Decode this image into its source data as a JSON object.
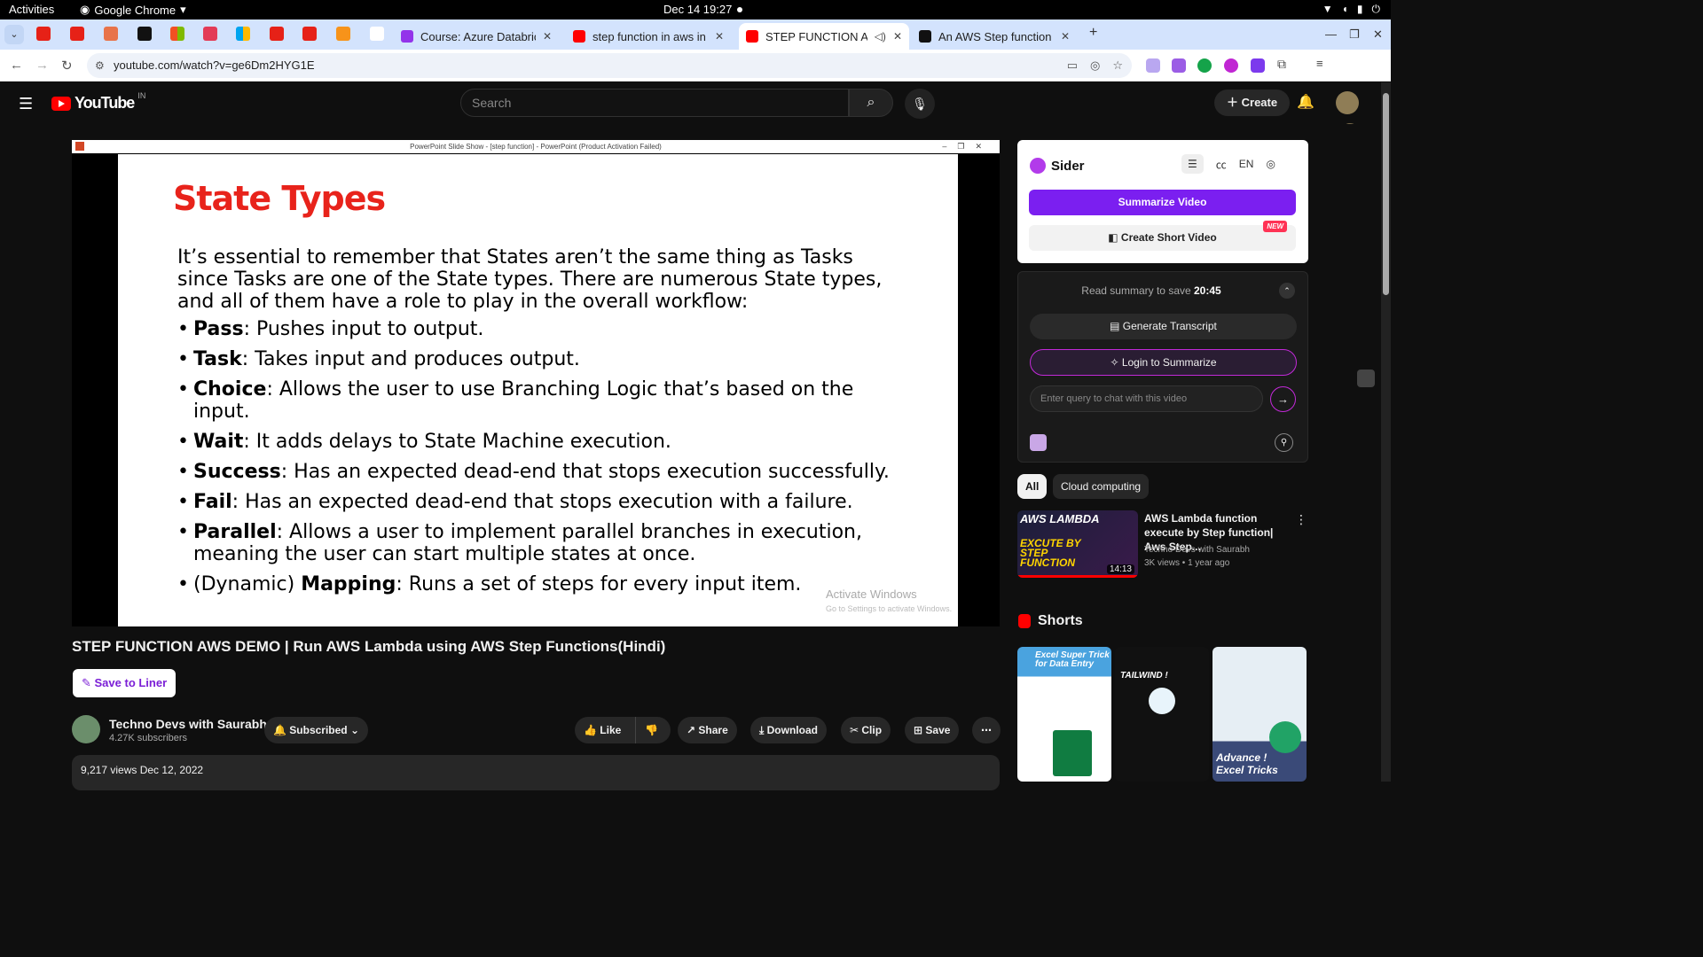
{
  "system": {
    "activities": "Activities",
    "app": "Google Chrome",
    "clock": "Dec 14  19:27"
  },
  "tabs": [
    {
      "label": "Course: Azure Databricks",
      "fav": "#9333ea"
    },
    {
      "label": "step function in aws in h",
      "fav": "#ff0000"
    },
    {
      "label": "STEP FUNCTION AWS",
      "fav": "#ff0000",
      "active": true
    },
    {
      "label": "An AWS Step function C",
      "fav": "#111111"
    }
  ],
  "address": {
    "url": "youtube.com/watch?v=ge6Dm2HYG1E"
  },
  "youtube": {
    "logo": "YouTube",
    "country": "IN",
    "search_placeholder": "Search",
    "create": "Create"
  },
  "player": {
    "window_title": "PowerPoint Slide Show - [step function] - PowerPoint (Product Activation Failed)",
    "slide_title": "State Types",
    "intro": "It’s essential to remember that States aren’t the same thing as Tasks since Tasks are one of the State types. There are numerous State types, and all of them have a role to play in the overall workflow:",
    "bullets": [
      {
        "pre": "",
        "term": "Pass",
        "desc": ": Pushes input to output."
      },
      {
        "pre": "",
        "term": "Task",
        "desc": ": Takes input and produces output."
      },
      {
        "pre": "",
        "term": "Choice",
        "desc": ": Allows the user to use Branching Logic that’s based on the input."
      },
      {
        "pre": "",
        "term": "Wait",
        "desc": ": It adds delays to State Machine execution."
      },
      {
        "pre": "",
        "term": "Success",
        "desc": ": Has an expected dead-end that stops execution successfully."
      },
      {
        "pre": "",
        "term": "Fail",
        "desc": ": Has an expected dead-end that stops execution with a failure."
      },
      {
        "pre": "",
        "term": "Parallel",
        "desc": ": Allows a user to implement parallel branches in execution, meaning the user can start multiple states at once."
      },
      {
        "pre": "(Dynamic) ",
        "term": "Mapping",
        "desc": ": Runs a set of steps for every input item."
      }
    ],
    "activate_1": "Activate Windows",
    "activate_2": "Go to Settings to activate Windows."
  },
  "video": {
    "title": "STEP FUNCTION AWS DEMO | Run AWS Lambda using AWS Step Functions(Hindi)",
    "liner": "Save to Liner",
    "channel": "Techno Devs with Saurabh",
    "subscribers": "4.27K subscribers",
    "subscribed": "Subscribed",
    "like": "Like",
    "share": "Share",
    "download": "Download",
    "clip": "Clip",
    "save": "Save",
    "views": "9,217 views  Dec 12, 2022"
  },
  "sider": {
    "brand": "Sider",
    "lang": "EN",
    "summarize": "Summarize Video",
    "short_video": "Create Short Video",
    "new_badge": "NEW",
    "read_prefix": "Read summary to save ",
    "read_time": "20:45",
    "transcript": "Generate Transcript",
    "login": "Login to Summarize",
    "query_placeholder": "Enter query to chat with this video"
  },
  "chips": [
    "All",
    "Cloud computing"
  ],
  "recommended": {
    "thumb_line1": "AWS LAMBDA",
    "thumb_line2": "EXCUTE BY STEP FUNCTION",
    "duration": "14:13",
    "title": "AWS Lambda function execute by Step function| Aws Step...",
    "channel": "Techno Devs with Saurabh",
    "meta": "3K views  •  1 year ago"
  },
  "shorts": {
    "heading": "Shorts",
    "cards": [
      {
        "caption": "Excel Super Trick for Data Entry"
      },
      {
        "caption": "TAILWIND !"
      },
      {
        "caption": "Advance ! Excel Tricks"
      }
    ]
  }
}
